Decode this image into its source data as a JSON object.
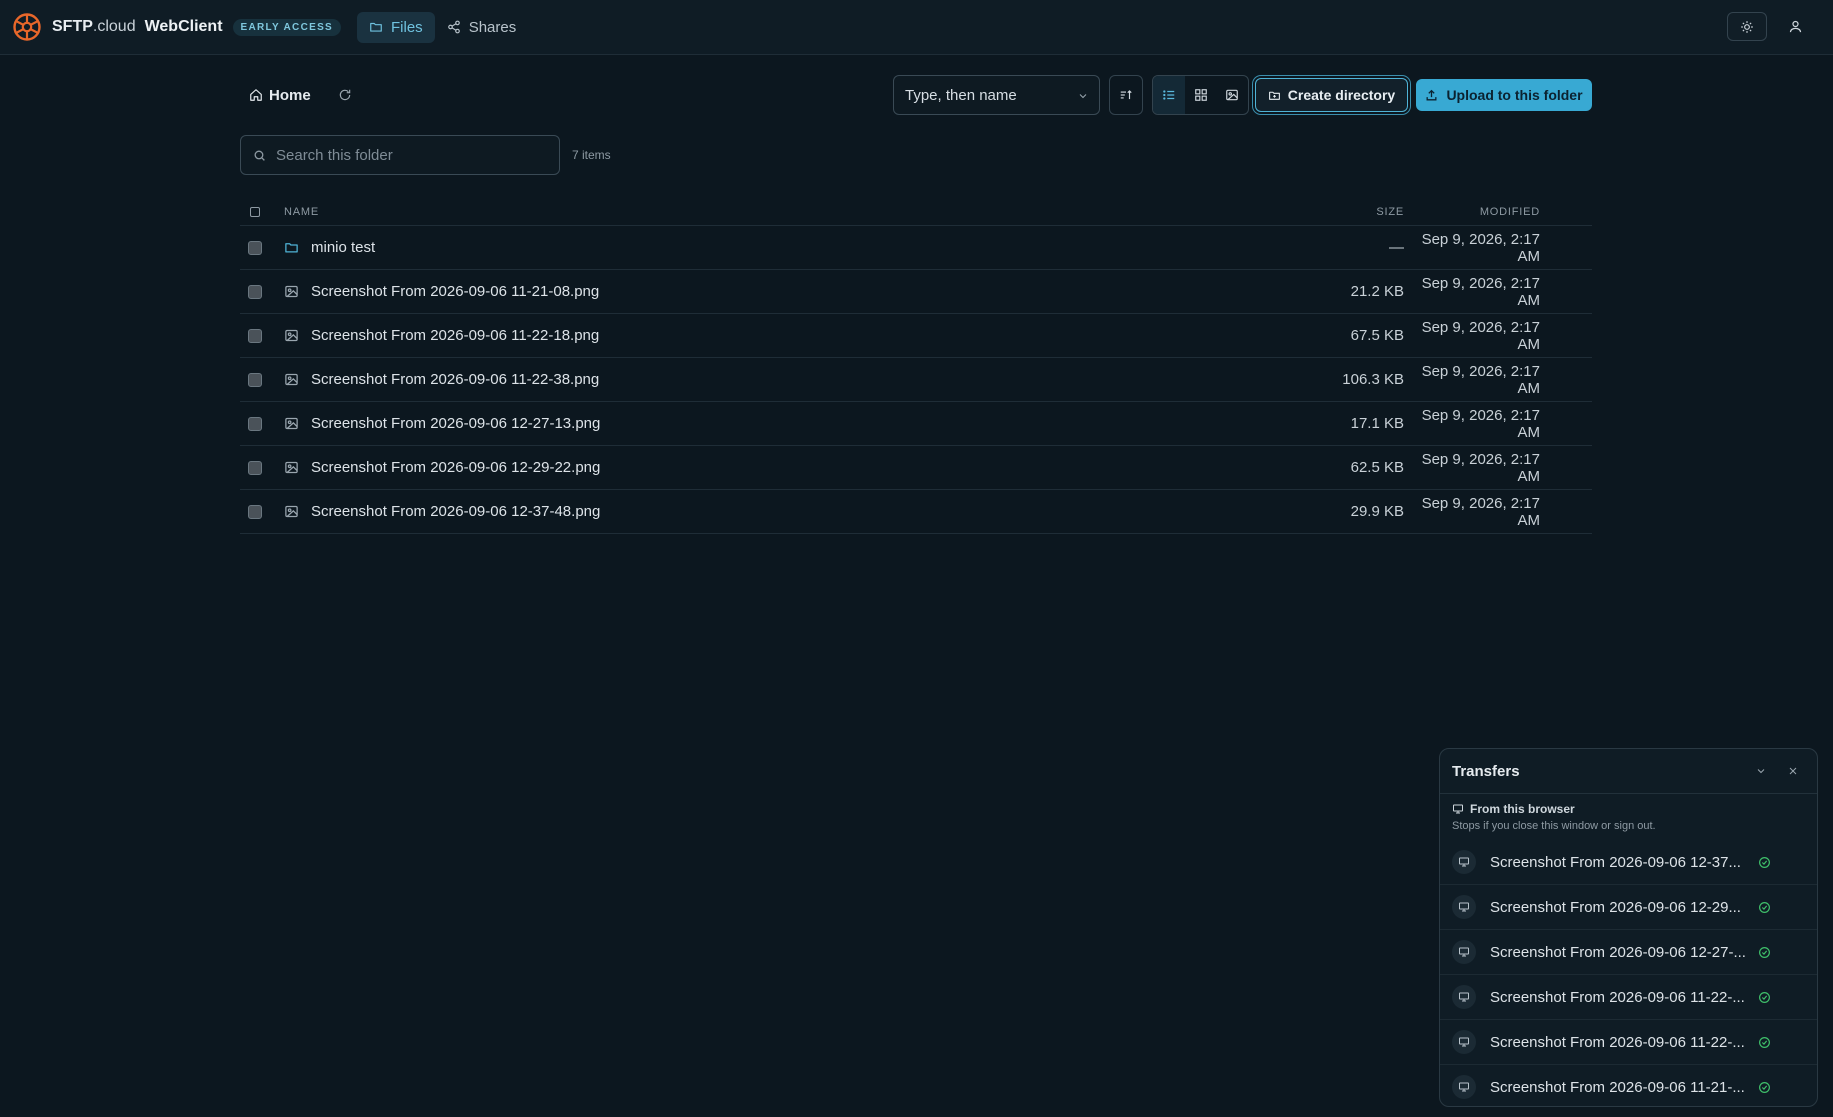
{
  "brand": {
    "name_bold": "SFTP",
    "name_dot": ".",
    "name_rest": "cloud",
    "app": "WebClient",
    "badge": "EARLY ACCESS",
    "logo_color": "#e8672a"
  },
  "nav": [
    {
      "label": "Files",
      "icon": "folder-icon",
      "active": true
    },
    {
      "label": "Shares",
      "icon": "share-icon",
      "active": false
    }
  ],
  "breadcrumb": {
    "home_label": "Home"
  },
  "toolbar": {
    "sort_value": "Type, then name",
    "create_label": "Create directory",
    "upload_label": "Upload to this folder",
    "views": [
      "list-view-icon",
      "grid-view-icon",
      "gallery-view-icon"
    ],
    "active_view": "list"
  },
  "search": {
    "placeholder": "Search this folder",
    "value": "",
    "count_label": "7 items"
  },
  "table": {
    "headers": {
      "name": "NAME",
      "size": "SIZE",
      "modified": "MODIFIED"
    },
    "rows": [
      {
        "type": "folder",
        "name": "minio test",
        "size": "—",
        "modified": "Sep 9, 2026, 2:17 AM"
      },
      {
        "type": "image",
        "name": "Screenshot From 2026-09-06 11-21-08.png",
        "size": "21.2 KB",
        "modified": "Sep 9, 2026, 2:17 AM"
      },
      {
        "type": "image",
        "name": "Screenshot From 2026-09-06 11-22-18.png",
        "size": "67.5 KB",
        "modified": "Sep 9, 2026, 2:17 AM"
      },
      {
        "type": "image",
        "name": "Screenshot From 2026-09-06 11-22-38.png",
        "size": "106.3 KB",
        "modified": "Sep 9, 2026, 2:17 AM"
      },
      {
        "type": "image",
        "name": "Screenshot From 2026-09-06 12-27-13.png",
        "size": "17.1 KB",
        "modified": "Sep 9, 2026, 2:17 AM"
      },
      {
        "type": "image",
        "name": "Screenshot From 2026-09-06 12-29-22.png",
        "size": "62.5 KB",
        "modified": "Sep 9, 2026, 2:17 AM"
      },
      {
        "type": "image",
        "name": "Screenshot From 2026-09-06 12-37-48.png",
        "size": "29.9 KB",
        "modified": "Sep 9, 2026, 2:17 AM"
      }
    ]
  },
  "transfers": {
    "title": "Transfers",
    "section_title": "From this browser",
    "section_subtitle": "Stops if you close this window or sign out.",
    "items": [
      {
        "name": "Screenshot From 2026-09-06 12-37...",
        "status": "done"
      },
      {
        "name": "Screenshot From 2026-09-06 12-29...",
        "status": "done"
      },
      {
        "name": "Screenshot From 2026-09-06 12-27-...",
        "status": "done"
      },
      {
        "name": "Screenshot From 2026-09-06 11-22-...",
        "status": "done"
      },
      {
        "name": "Screenshot From 2026-09-06 11-22-...",
        "status": "done"
      },
      {
        "name": "Screenshot From 2026-09-06 11-21-...",
        "status": "done"
      }
    ]
  },
  "colors": {
    "accent": "#38a9d3",
    "success": "#3fbf6a",
    "background": "#0c171f"
  }
}
